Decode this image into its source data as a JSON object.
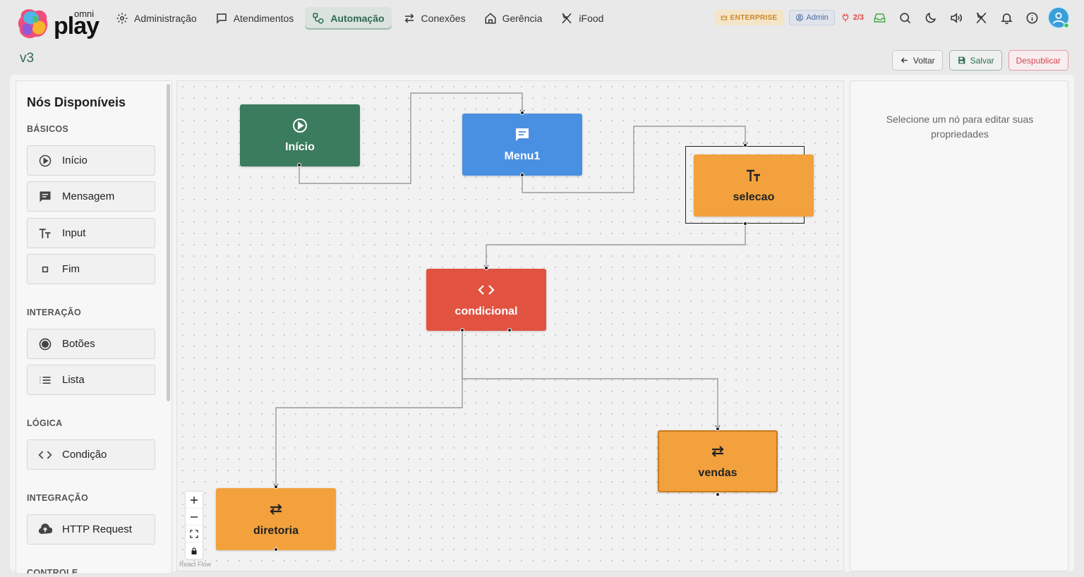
{
  "brand": {
    "small": "omni",
    "large": "play"
  },
  "nav": [
    {
      "label": "Administração",
      "icon": "gear-icon"
    },
    {
      "label": "Atendimentos",
      "icon": "chat-icon"
    },
    {
      "label": "Automação",
      "icon": "flow-icon",
      "active": true
    },
    {
      "label": "Conexões",
      "icon": "arrows-icon"
    },
    {
      "label": "Gerência",
      "icon": "home-icon"
    },
    {
      "label": "iFood",
      "icon": "utensils-icon"
    }
  ],
  "header": {
    "enterprise": "ENTERPRISE",
    "admin": "Admin",
    "connections": "2/3"
  },
  "page": {
    "title": "v3"
  },
  "actions": {
    "back": "Voltar",
    "save": "Salvar",
    "unpublish": "Despublicar"
  },
  "sidebar": {
    "title": "Nós Disponíveis",
    "categories": {
      "basic": "BÁSICOS",
      "interaction": "INTERAÇÃO",
      "logic": "LÓGICA",
      "integration": "INTEGRAÇÃO",
      "control": "CONTROLE"
    },
    "items": {
      "start": "Início",
      "message": "Mensagem",
      "input": "Input",
      "end": "Fim",
      "buttons": "Botões",
      "list": "Lista",
      "condition": "Condição",
      "http": "HTTP Request"
    }
  },
  "flow": {
    "nodes": {
      "inicio": "Início",
      "menu1": "Menu1",
      "selecao": "selecao",
      "condicional": "condicional",
      "diretoria": "diretoria",
      "vendas": "vendas"
    },
    "attribution": "React Flow"
  },
  "properties": {
    "empty_message": "Selecione um nó para editar suas propriedades"
  },
  "colors": {
    "accent": "#2e6b4f",
    "node_start": "#3b7b5e",
    "node_message": "#4a90e2",
    "node_condition": "#e15241",
    "node_input": "#f2a13d",
    "danger": "#d64550"
  }
}
